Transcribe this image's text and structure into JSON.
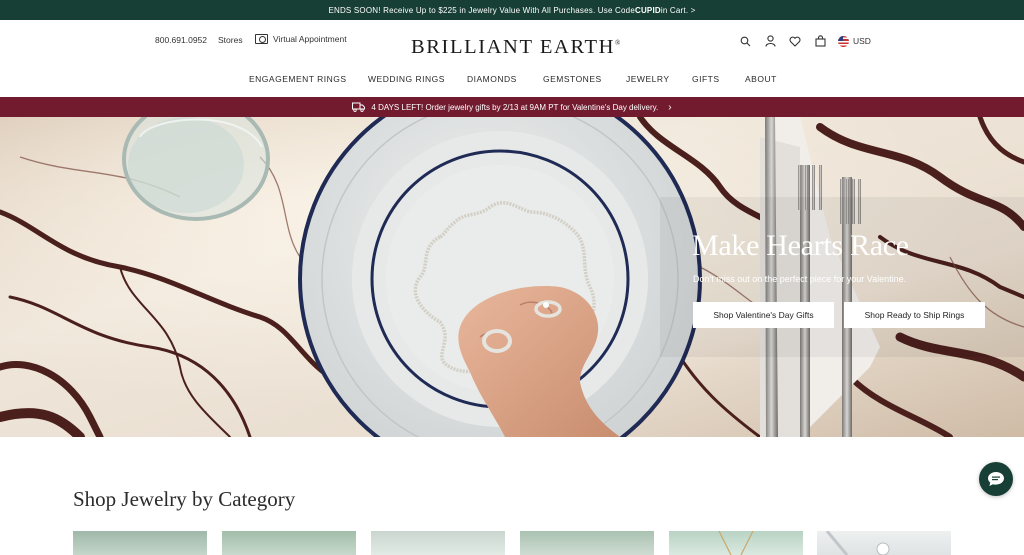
{
  "promo_top": {
    "prefix": "ENDS SOON! Receive Up to $225 in Jewelry Value With All Purchases. Use Code ",
    "code": "CUPID",
    "suffix": " in Cart. >"
  },
  "header": {
    "phone": "800.691.0952",
    "stores": "Stores",
    "virtual_appointment": "Virtual Appointment",
    "logo": "BRILLIANT EARTH",
    "logo_mark": "®",
    "currency": "USD",
    "icons": [
      "search-icon",
      "account-icon",
      "wishlist-heart-icon",
      "shopping-bag-icon",
      "us-flag-icon"
    ]
  },
  "nav": {
    "items": [
      "ENGAGEMENT RINGS",
      "WEDDING RINGS",
      "DIAMONDS",
      "GEMSTONES",
      "JEWELRY",
      "GIFTS",
      "ABOUT"
    ]
  },
  "valentine_bar": {
    "text": "4 DAYS LEFT! Order jewelry gifts by 2/13 at 9AM PT for Valentine's Day delivery.",
    "chevron": "›"
  },
  "hero": {
    "title": "Make Hearts Race",
    "subtitle": "Don't miss out on the perfect piece for your Valentine.",
    "button_primary": "Shop Valentine's Day Gifts",
    "button_secondary": "Shop Ready to Ship Rings"
  },
  "category": {
    "title": "Shop Jewelry by Category"
  },
  "colors": {
    "promo_green": "#173f35",
    "valentine_red": "#721b2f",
    "text_dark": "#2b2b2b"
  }
}
